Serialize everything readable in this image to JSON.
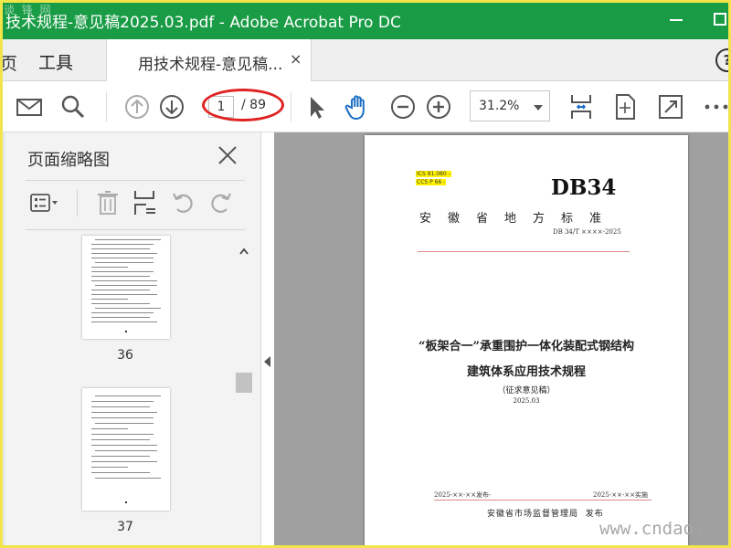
{
  "window": {
    "title": "技术规程-意见稿2025.03.pdf - Adobe Acrobat Pro DC",
    "watermark_top": "谈 锋 网"
  },
  "tabs": {
    "home_fragment": "页",
    "tools": "工具",
    "document": "用技术规程-意见稿...",
    "close_glyph": "×",
    "help_glyph": "?"
  },
  "toolbar": {
    "page_current": "1",
    "page_total": "/ 89",
    "zoom": "31.2%",
    "icons": [
      "mail-icon",
      "search-icon",
      "page-up-icon",
      "page-down-icon",
      "select-arrow-icon",
      "hand-icon",
      "zoom-out-icon",
      "zoom-in-icon",
      "scroll-mode-icon",
      "fit-page-icon",
      "fullscreen-icon",
      "more-icon"
    ]
  },
  "left_panel": {
    "title": "页面缩略图",
    "thumbnails": [
      {
        "page": "36"
      },
      {
        "page": "37"
      }
    ]
  },
  "document_page": {
    "ics": "ICS 91.080 -",
    "ccs": "CCS P 66 -",
    "std_code": "DB34",
    "province": "安徽省地方标准",
    "std_number": "DB 34/T ××××-2025",
    "title_line1": "“板架合一”承重围护一体化装配式钢结构",
    "title_line2": "建筑体系应用技术规程",
    "draft_label": "（征求意见稿）",
    "date": "2025.03",
    "publish_date": "2025-××-××发布-",
    "implement_date": "2025-××-××实施",
    "issuer": "安徽省市场监督管理局",
    "issuer_suffix": "发布",
    "corner_watermark": "www.cndao."
  },
  "colors": {
    "title_bar": "#199c45",
    "annotation": "#e02222",
    "highlight": "#fff200"
  }
}
